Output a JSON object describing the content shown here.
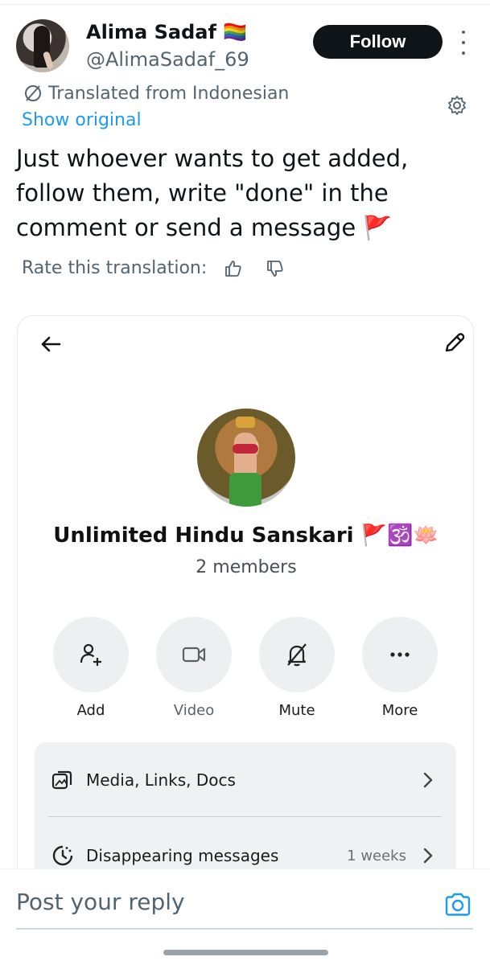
{
  "tweet": {
    "author_name": "Alima Sadaf 🏳️‍🌈",
    "handle": "@AlimaSadaf_69",
    "follow_label": "Follow",
    "translated_label": "Translated from Indonesian",
    "show_original_label": "Show original",
    "text": "Just whoever wants to get added, follow them, write \"done\" in the comment or send a message 🚩",
    "rate_label": "Rate this translation:"
  },
  "card": {
    "group_name": "Unlimited Hindu Sanskari 🚩🕉️🪷",
    "members": "2 members",
    "actions": [
      {
        "label": "Add",
        "icon": "add-person-icon"
      },
      {
        "label": "Video",
        "icon": "video-icon"
      },
      {
        "label": "Mute",
        "icon": "bell-off-icon"
      },
      {
        "label": "More",
        "icon": "more-dots-icon"
      }
    ],
    "rows": [
      {
        "label": "Media, Links, Docs",
        "value": "",
        "icon": "media-icon"
      },
      {
        "label": "Disappearing messages",
        "value": "1 weeks",
        "icon": "timer-icon"
      }
    ]
  },
  "reply": {
    "placeholder": "Post your reply"
  },
  "colors": {
    "link": "#1d9bf0",
    "secondary_text": "#536471",
    "follow_bg": "#0f1419",
    "panel_bg": "#f0f1f3"
  }
}
